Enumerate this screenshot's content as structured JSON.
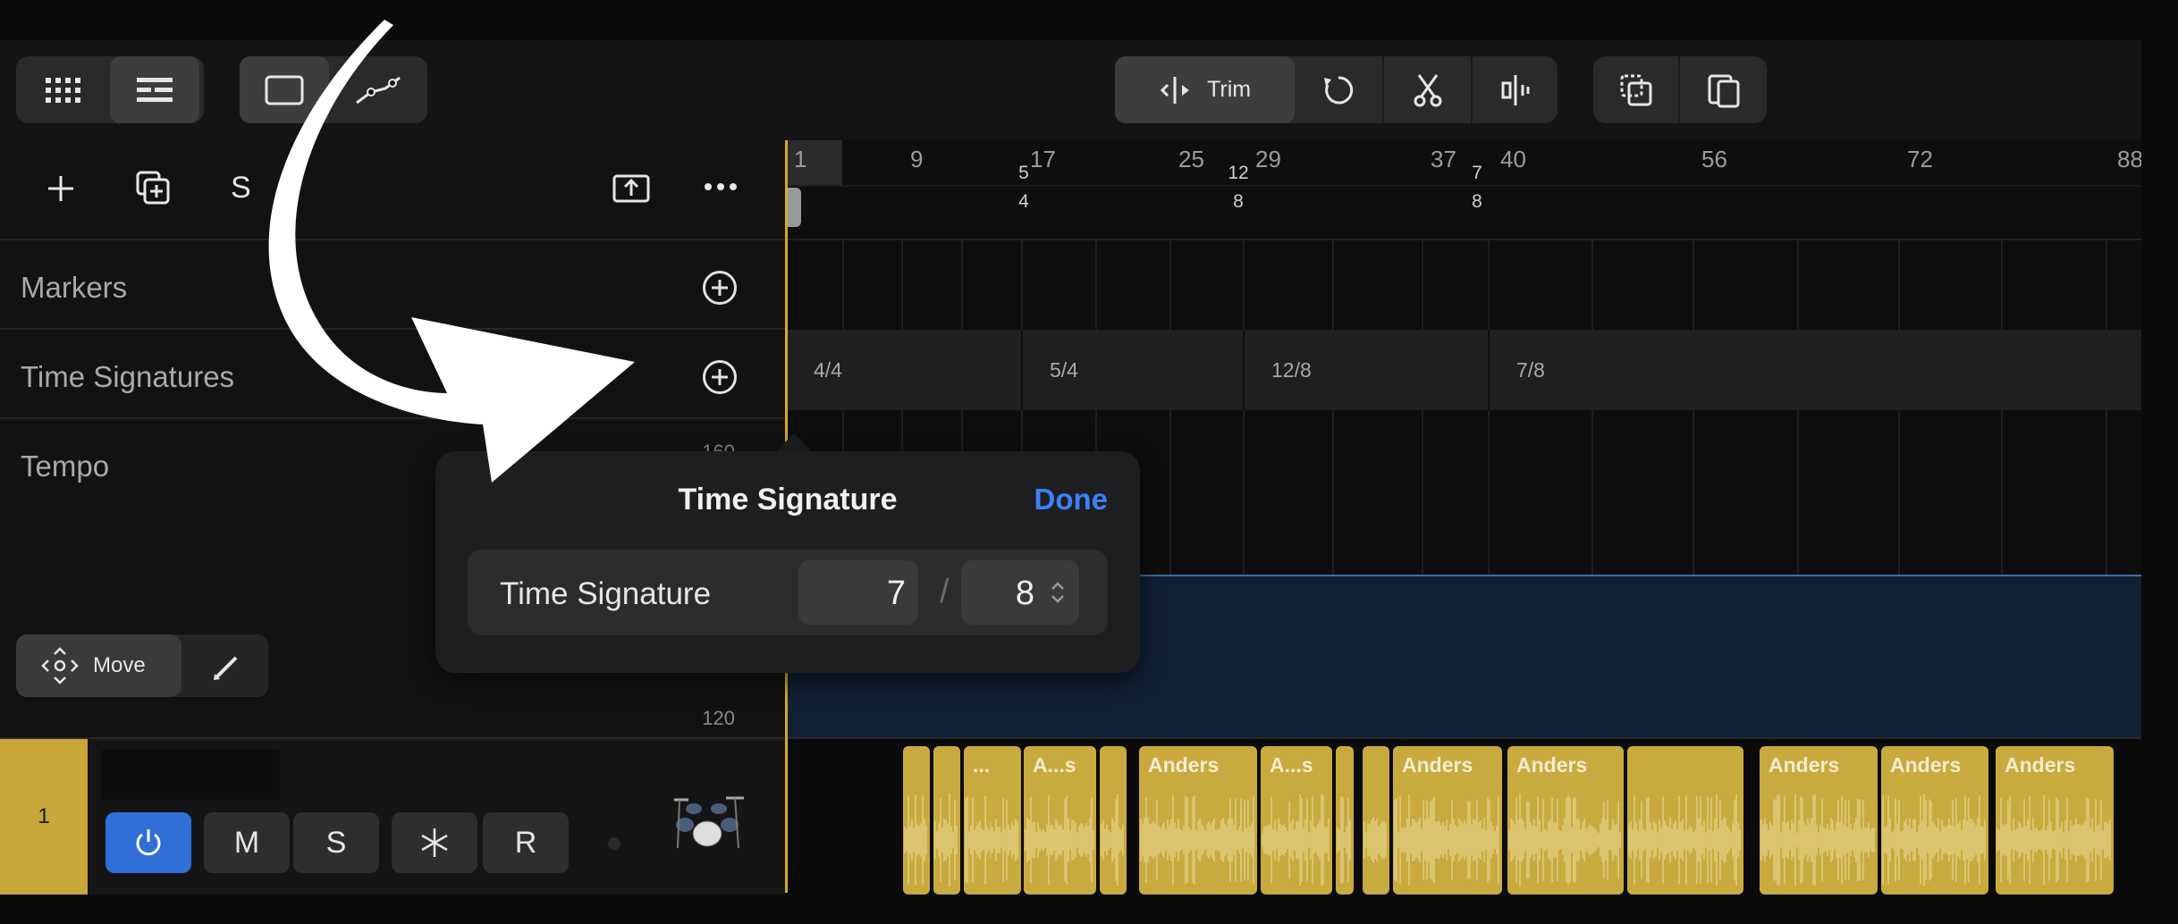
{
  "toolbar": {
    "trim_label": "Trim"
  },
  "header_row": {
    "s_label": "S"
  },
  "rows": {
    "markers": "Markers",
    "time_signatures": "Time Signatures",
    "tempo": "Tempo"
  },
  "tempo_scale": {
    "top": "160",
    "bottom": "120"
  },
  "move_tool": {
    "label": "Move"
  },
  "ruler": {
    "bars": [
      "1",
      "9",
      "17",
      "25",
      "29",
      "37",
      "40",
      "56",
      "72",
      "88"
    ],
    "sig_markers": [
      {
        "num": "5",
        "den": "4"
      },
      {
        "num": "12",
        "den": "8"
      },
      {
        "num": "7",
        "den": "8"
      }
    ]
  },
  "time_signature_cells": [
    "4/4",
    "5/4",
    "12/8",
    "7/8"
  ],
  "popover": {
    "title": "Time Signature",
    "done": "Done",
    "row_label": "Time Signature",
    "numerator": "7",
    "separator": "/",
    "denominator": "8"
  },
  "track": {
    "number": "1",
    "buttons": {
      "mute": "M",
      "solo": "S",
      "record": "R"
    },
    "regions": [
      "",
      "",
      "...",
      "A...s",
      "",
      "Anders",
      "A...s",
      "",
      "",
      "Anders",
      "Anders",
      "",
      "Anders",
      "Anders",
      "Anders"
    ]
  },
  "colors": {
    "accent_blue": "#3b82f6",
    "region_gold": "#c9aa3e",
    "playhead": "#d4aa2a",
    "tempo_fill": "#102035"
  }
}
